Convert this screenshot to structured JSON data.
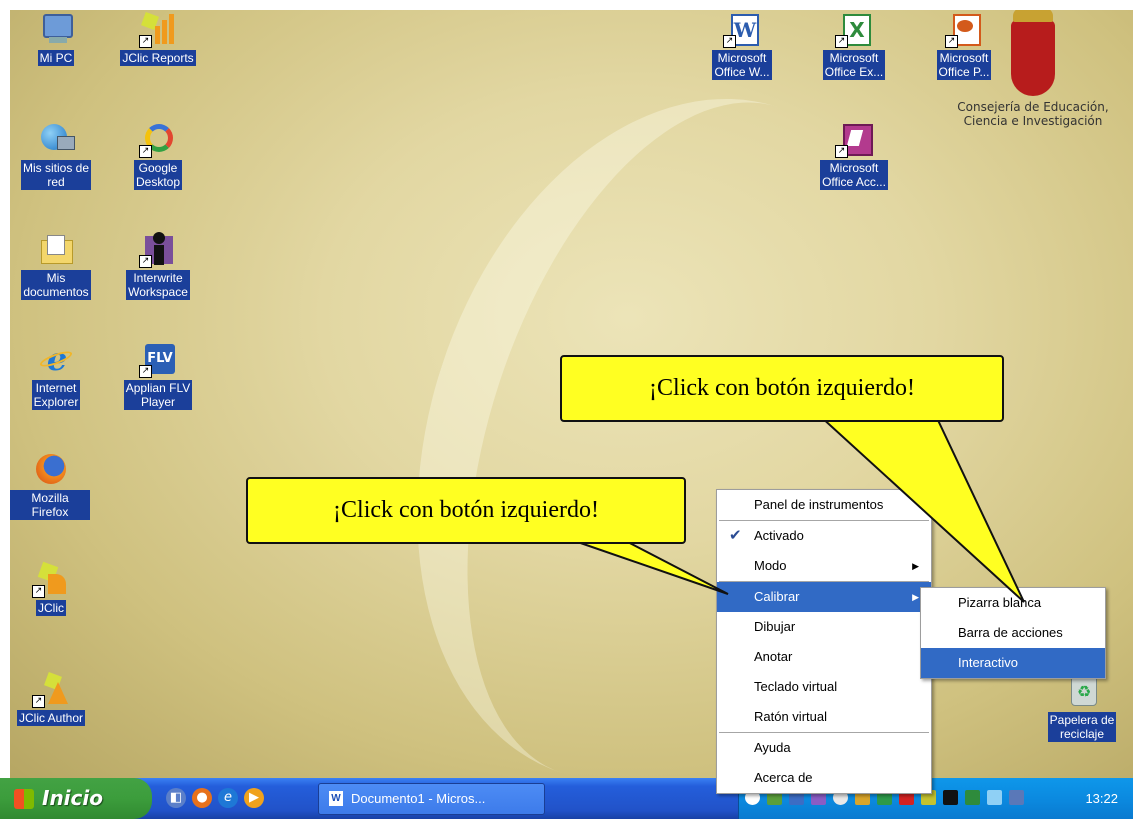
{
  "desktop_icons": [
    {
      "label_lines": [
        "Mi PC"
      ],
      "icon": "computer-icon"
    },
    {
      "label_lines": [
        "JClic Reports"
      ],
      "icon": "jclic-reports-icon"
    },
    {
      "label_lines": [
        "Mis sitios de",
        "red"
      ],
      "icon": "network-places-icon"
    },
    {
      "label_lines": [
        "Google",
        "Desktop"
      ],
      "icon": "google-desktop-icon"
    },
    {
      "label_lines": [
        "Mis",
        "documentos"
      ],
      "icon": "my-documents-icon"
    },
    {
      "label_lines": [
        "Interwrite",
        "Workspace"
      ],
      "icon": "interwrite-icon"
    },
    {
      "label_lines": [
        "Internet",
        "Explorer"
      ],
      "icon": "internet-explorer-icon"
    },
    {
      "label_lines": [
        "Applian FLV",
        "Player"
      ],
      "icon": "flv-player-icon"
    },
    {
      "label_lines": [
        "Mozilla Firefox"
      ],
      "icon": "firefox-icon"
    },
    {
      "label_lines": [
        "JClic"
      ],
      "icon": "jclic-icon"
    },
    {
      "label_lines": [
        "JClic Author"
      ],
      "icon": "jclic-author-icon"
    },
    {
      "label_lines": [
        "Microsoft",
        "Office W..."
      ],
      "icon": "word-icon"
    },
    {
      "label_lines": [
        "Microsoft",
        "Office Ex..."
      ],
      "icon": "excel-icon"
    },
    {
      "label_lines": [
        "Microsoft",
        "Office P..."
      ],
      "icon": "powerpoint-icon"
    },
    {
      "label_lines": [
        "Microsoft",
        "Office Acc..."
      ],
      "icon": "access-icon"
    },
    {
      "label_lines": [
        "Papelera de",
        "reciclaje"
      ],
      "icon": "recycle-bin-icon"
    }
  ],
  "crest": {
    "line1": "Consejería de Educación,",
    "line2": "Ciencia e Investigación"
  },
  "callouts": {
    "left": "¡Click con botón izquierdo!",
    "right": "¡Click con botón izquierdo!"
  },
  "context_menu": {
    "items": [
      {
        "label": "Panel de instrumentos"
      },
      {
        "label": "Activado",
        "checked": true
      },
      {
        "label": "Modo",
        "submenu": true
      },
      {
        "label": "Calibrar",
        "submenu": true,
        "selected": true
      },
      {
        "label": "Dibujar"
      },
      {
        "label": "Anotar"
      },
      {
        "label": "Teclado virtual"
      },
      {
        "label": "Ratón virtual"
      },
      {
        "label": "Ayuda"
      },
      {
        "label": "Acerca de"
      }
    ]
  },
  "sub_menu": {
    "items": [
      {
        "label": "Pizarra blanca"
      },
      {
        "label": "Barra de acciones"
      },
      {
        "label": "Interactivo",
        "selected": true
      }
    ]
  },
  "taskbar": {
    "start_label": "Inicio",
    "task_button": "Documento1 - Micros...",
    "clock": "13:22"
  }
}
